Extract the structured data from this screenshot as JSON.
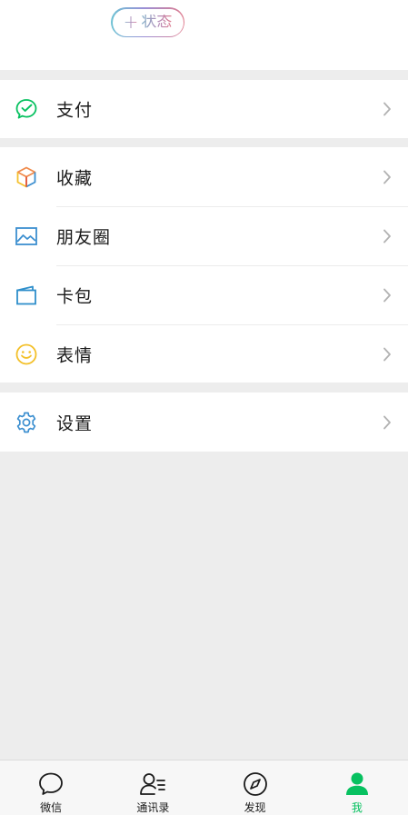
{
  "status_button": {
    "plus": "+",
    "label": "状态"
  },
  "menu": {
    "pay": {
      "label": "支付"
    },
    "main": [
      {
        "key": "favorites",
        "label": "收藏"
      },
      {
        "key": "moments",
        "label": "朋友圈"
      },
      {
        "key": "cards",
        "label": "卡包"
      },
      {
        "key": "stickers",
        "label": "表情"
      }
    ],
    "settings": {
      "label": "设置"
    }
  },
  "tabbar": {
    "tabs": [
      {
        "key": "chats",
        "label": "微信",
        "icon": "chat-bubble-icon",
        "active": false
      },
      {
        "key": "contacts",
        "label": "通讯录",
        "icon": "contacts-icon",
        "active": false
      },
      {
        "key": "discover",
        "label": "发现",
        "icon": "compass-icon",
        "active": false
      },
      {
        "key": "me",
        "label": "我",
        "icon": "person-icon",
        "active": true
      }
    ]
  },
  "colors": {
    "accent": "#07c160",
    "background": "#ededed",
    "pay_icon": "#07c160",
    "moments_icon": "#3c8fd0",
    "cards_icon": "#2f8fcb",
    "stickers_icon": "#f3c02a",
    "settings_icon": "#3c8fd0"
  }
}
